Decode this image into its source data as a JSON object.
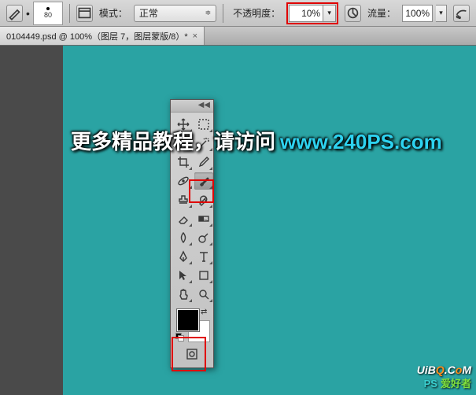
{
  "options_bar": {
    "brush_size": "80",
    "mode_label": "模式：",
    "mode_value": "正常",
    "opacity_label": "不透明度：",
    "opacity_value": "10%",
    "flow_label": "流量：",
    "flow_value": "100%"
  },
  "document_tab": {
    "title": "0104449.psd @ 100%（图层 7，图层蒙版/8）*"
  },
  "colors": {
    "canvas": "#2aa3a3",
    "highlight": "#e00000",
    "foreground_swatch": "#000000",
    "background_swatch": "#ffffff"
  },
  "tools": [
    {
      "name": "move-tool",
      "icon": "move"
    },
    {
      "name": "marquee-tool",
      "icon": "marquee"
    },
    {
      "name": "lasso-tool",
      "icon": "lasso"
    },
    {
      "name": "magic-wand-tool",
      "icon": "wand"
    },
    {
      "name": "crop-tool",
      "icon": "crop"
    },
    {
      "name": "eyedropper-tool",
      "icon": "eyedropper"
    },
    {
      "name": "healing-brush-tool",
      "icon": "bandaid"
    },
    {
      "name": "brush-tool",
      "icon": "brush",
      "selected": true
    },
    {
      "name": "clone-stamp-tool",
      "icon": "stamp"
    },
    {
      "name": "history-brush-tool",
      "icon": "historybrush"
    },
    {
      "name": "eraser-tool",
      "icon": "eraser"
    },
    {
      "name": "gradient-tool",
      "icon": "gradient"
    },
    {
      "name": "blur-tool",
      "icon": "blur"
    },
    {
      "name": "dodge-tool",
      "icon": "dodge"
    },
    {
      "name": "pen-tool",
      "icon": "pen"
    },
    {
      "name": "type-tool",
      "icon": "type"
    },
    {
      "name": "path-selection-tool",
      "icon": "pathsel"
    },
    {
      "name": "shape-tool",
      "icon": "shape"
    },
    {
      "name": "hand-tool",
      "icon": "hand"
    },
    {
      "name": "zoom-tool",
      "icon": "zoom"
    }
  ],
  "watermark": {
    "text_prefix": "更多精品教程，请访问",
    "url": "www.240PS.com",
    "corner_ps": "PS",
    "corner_cn": "爱好者",
    "corner_site_1": "UiB",
    "corner_site_o": "Q",
    "corner_site_2": ".C",
    "corner_site_o2": "o",
    "corner_site_3": "M"
  }
}
